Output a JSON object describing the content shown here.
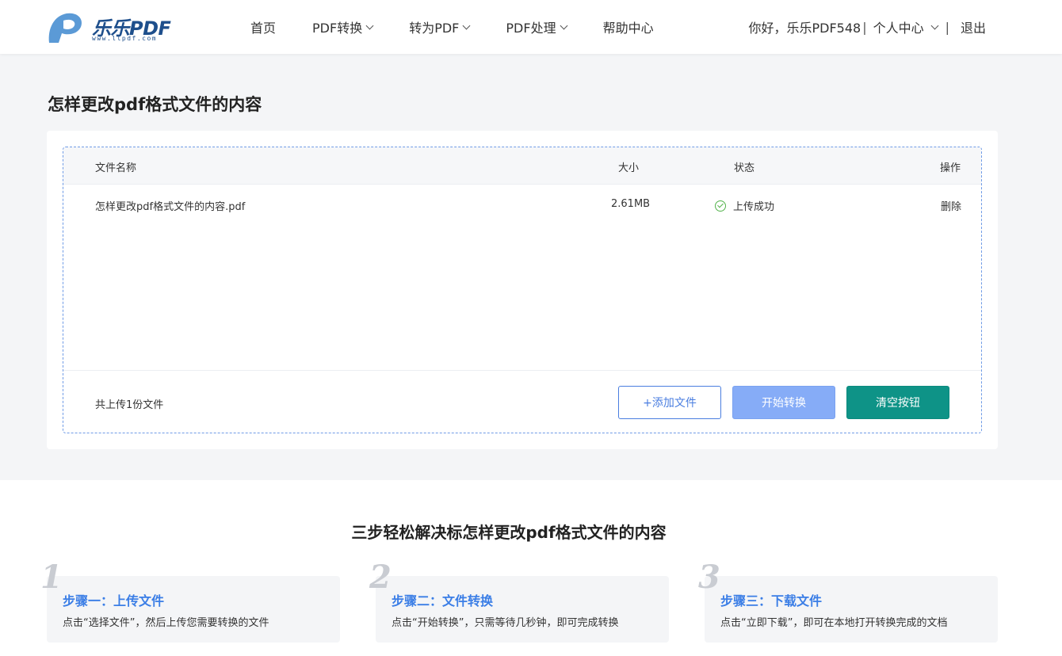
{
  "header": {
    "logo": {
      "text": "乐乐PDF",
      "url": "www.llpdf.com",
      "mark_icon": "pdf-logo-icon"
    },
    "nav": [
      {
        "label": "首页",
        "dropdown": false
      },
      {
        "label": "PDF转换",
        "dropdown": true
      },
      {
        "label": "转为PDF",
        "dropdown": true
      },
      {
        "label": "PDF处理",
        "dropdown": true
      },
      {
        "label": "帮助中心",
        "dropdown": false
      }
    ],
    "user": {
      "greeting": "你好，乐乐PDF548",
      "separator": "|",
      "center": "个人中心",
      "logout": "退出"
    }
  },
  "page_title": "怎样更改pdf格式文件的内容",
  "table": {
    "headers": {
      "name": "文件名称",
      "size": "大小",
      "status": "状态",
      "action": "操作"
    },
    "rows": [
      {
        "name": "怎样更改pdf格式文件的内容.pdf",
        "size": "2.61MB",
        "status": "上传成功",
        "action": "删除"
      }
    ]
  },
  "footer": {
    "count_text": "共上传1份文件",
    "add_button": "+添加文件",
    "start_button": "开始转换",
    "clear_button": "清空按钮"
  },
  "steps_section": {
    "title": "三步轻松解决标怎样更改pdf格式文件的内容",
    "steps": [
      {
        "num": "1",
        "title": "步骤一：上传文件",
        "desc": "点击“选择文件”，然后上传您需要转换的文件"
      },
      {
        "num": "2",
        "title": "步骤二：文件转换",
        "desc": "点击“开始转换”，只需等待几秒钟，即可完成转换"
      },
      {
        "num": "3",
        "title": "步骤三：下载文件",
        "desc": "点击“立即下载”，即可在本地打开转换完成的文档"
      }
    ]
  },
  "colors": {
    "brand_blue": "#1e4f8c",
    "accent_blue": "#3b7ee6",
    "start_button": "#86acf7",
    "clear_button": "#0e9387",
    "success": "#52b24a"
  }
}
